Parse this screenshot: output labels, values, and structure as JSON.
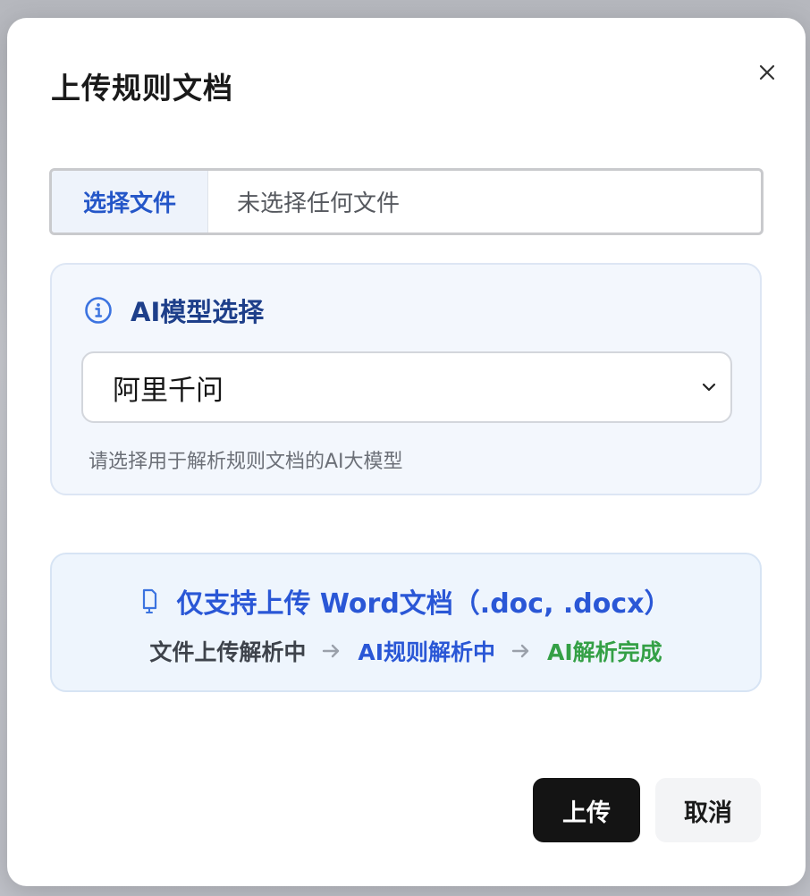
{
  "dialog": {
    "title": "上传规则文档",
    "close_icon": "close-icon"
  },
  "file_picker": {
    "button_label": "选择文件",
    "status_text": "未选择任何文件"
  },
  "model_section": {
    "icon": "info-icon",
    "title": "AI模型选择",
    "selected_value": "阿里千问",
    "dropdown_icon": "chevron-down-icon",
    "hint": "请选择用于解析规则文档的AI大模型"
  },
  "support_info": {
    "icon": "document-icon",
    "text": "仅支持上传 Word文档（.doc, .docx）",
    "steps": [
      {
        "label": "文件上传解析中",
        "color": "#3e434b"
      },
      {
        "label": "AI规则解析中",
        "color": "#2a57d6"
      },
      {
        "label": "AI解析完成",
        "color": "#34a046"
      }
    ],
    "arrow_icon": "arrow-right-icon"
  },
  "actions": {
    "upload_label": "上传",
    "cancel_label": "取消"
  },
  "colors": {
    "accent_blue": "#2a57d6",
    "success_green": "#34a046",
    "primary_button": "#141414"
  }
}
